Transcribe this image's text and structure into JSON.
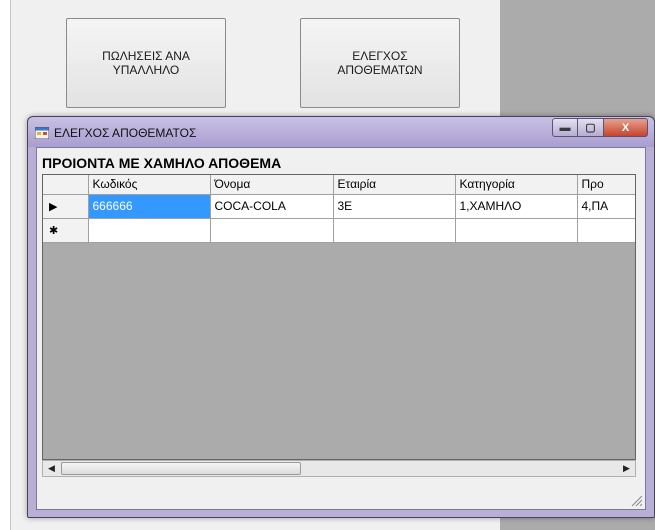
{
  "parent": {
    "buttons": {
      "sales_label": "ΠΩΛΗΣΕΙΣ ΑΝΑ\nΥΠΑΛΛΗΛΟ",
      "stock_label": "ΕΛΕΓΧΟΣ\nΑΠΟΘΕΜΑΤΩΝ"
    }
  },
  "window": {
    "title": "ΕΛΕΓΧΟΣ ΑΠΟΘΕΜΑΤΟΣ",
    "caption": {
      "minimize": "▬",
      "maximize": "▢",
      "close": "X"
    }
  },
  "section": {
    "label": "ΠΡΟΙΟΝΤΑ ΜΕ ΧΑΜΗΛΟ ΑΠΟΘΕΜΑ"
  },
  "grid": {
    "columns": [
      "Κωδικός",
      "Όνομα",
      "Εταιρία",
      "Κατηγορία",
      "Προ"
    ],
    "rows": [
      {
        "indicator": "▶",
        "cells": [
          "666666",
          "COCA-COLA",
          "3E",
          "1,ΧΑΜΗΛΟ",
          "4,ΠΑ"
        ]
      },
      {
        "indicator": "✱",
        "cells": [
          "",
          "",
          "",
          "",
          ""
        ]
      }
    ]
  },
  "scrollbar": {
    "left_arrow": "◀",
    "right_arrow": "▶"
  },
  "colors": {
    "selection": "#3399ff",
    "grid_background": "#ababab",
    "window_frame": "#b8aed6"
  }
}
